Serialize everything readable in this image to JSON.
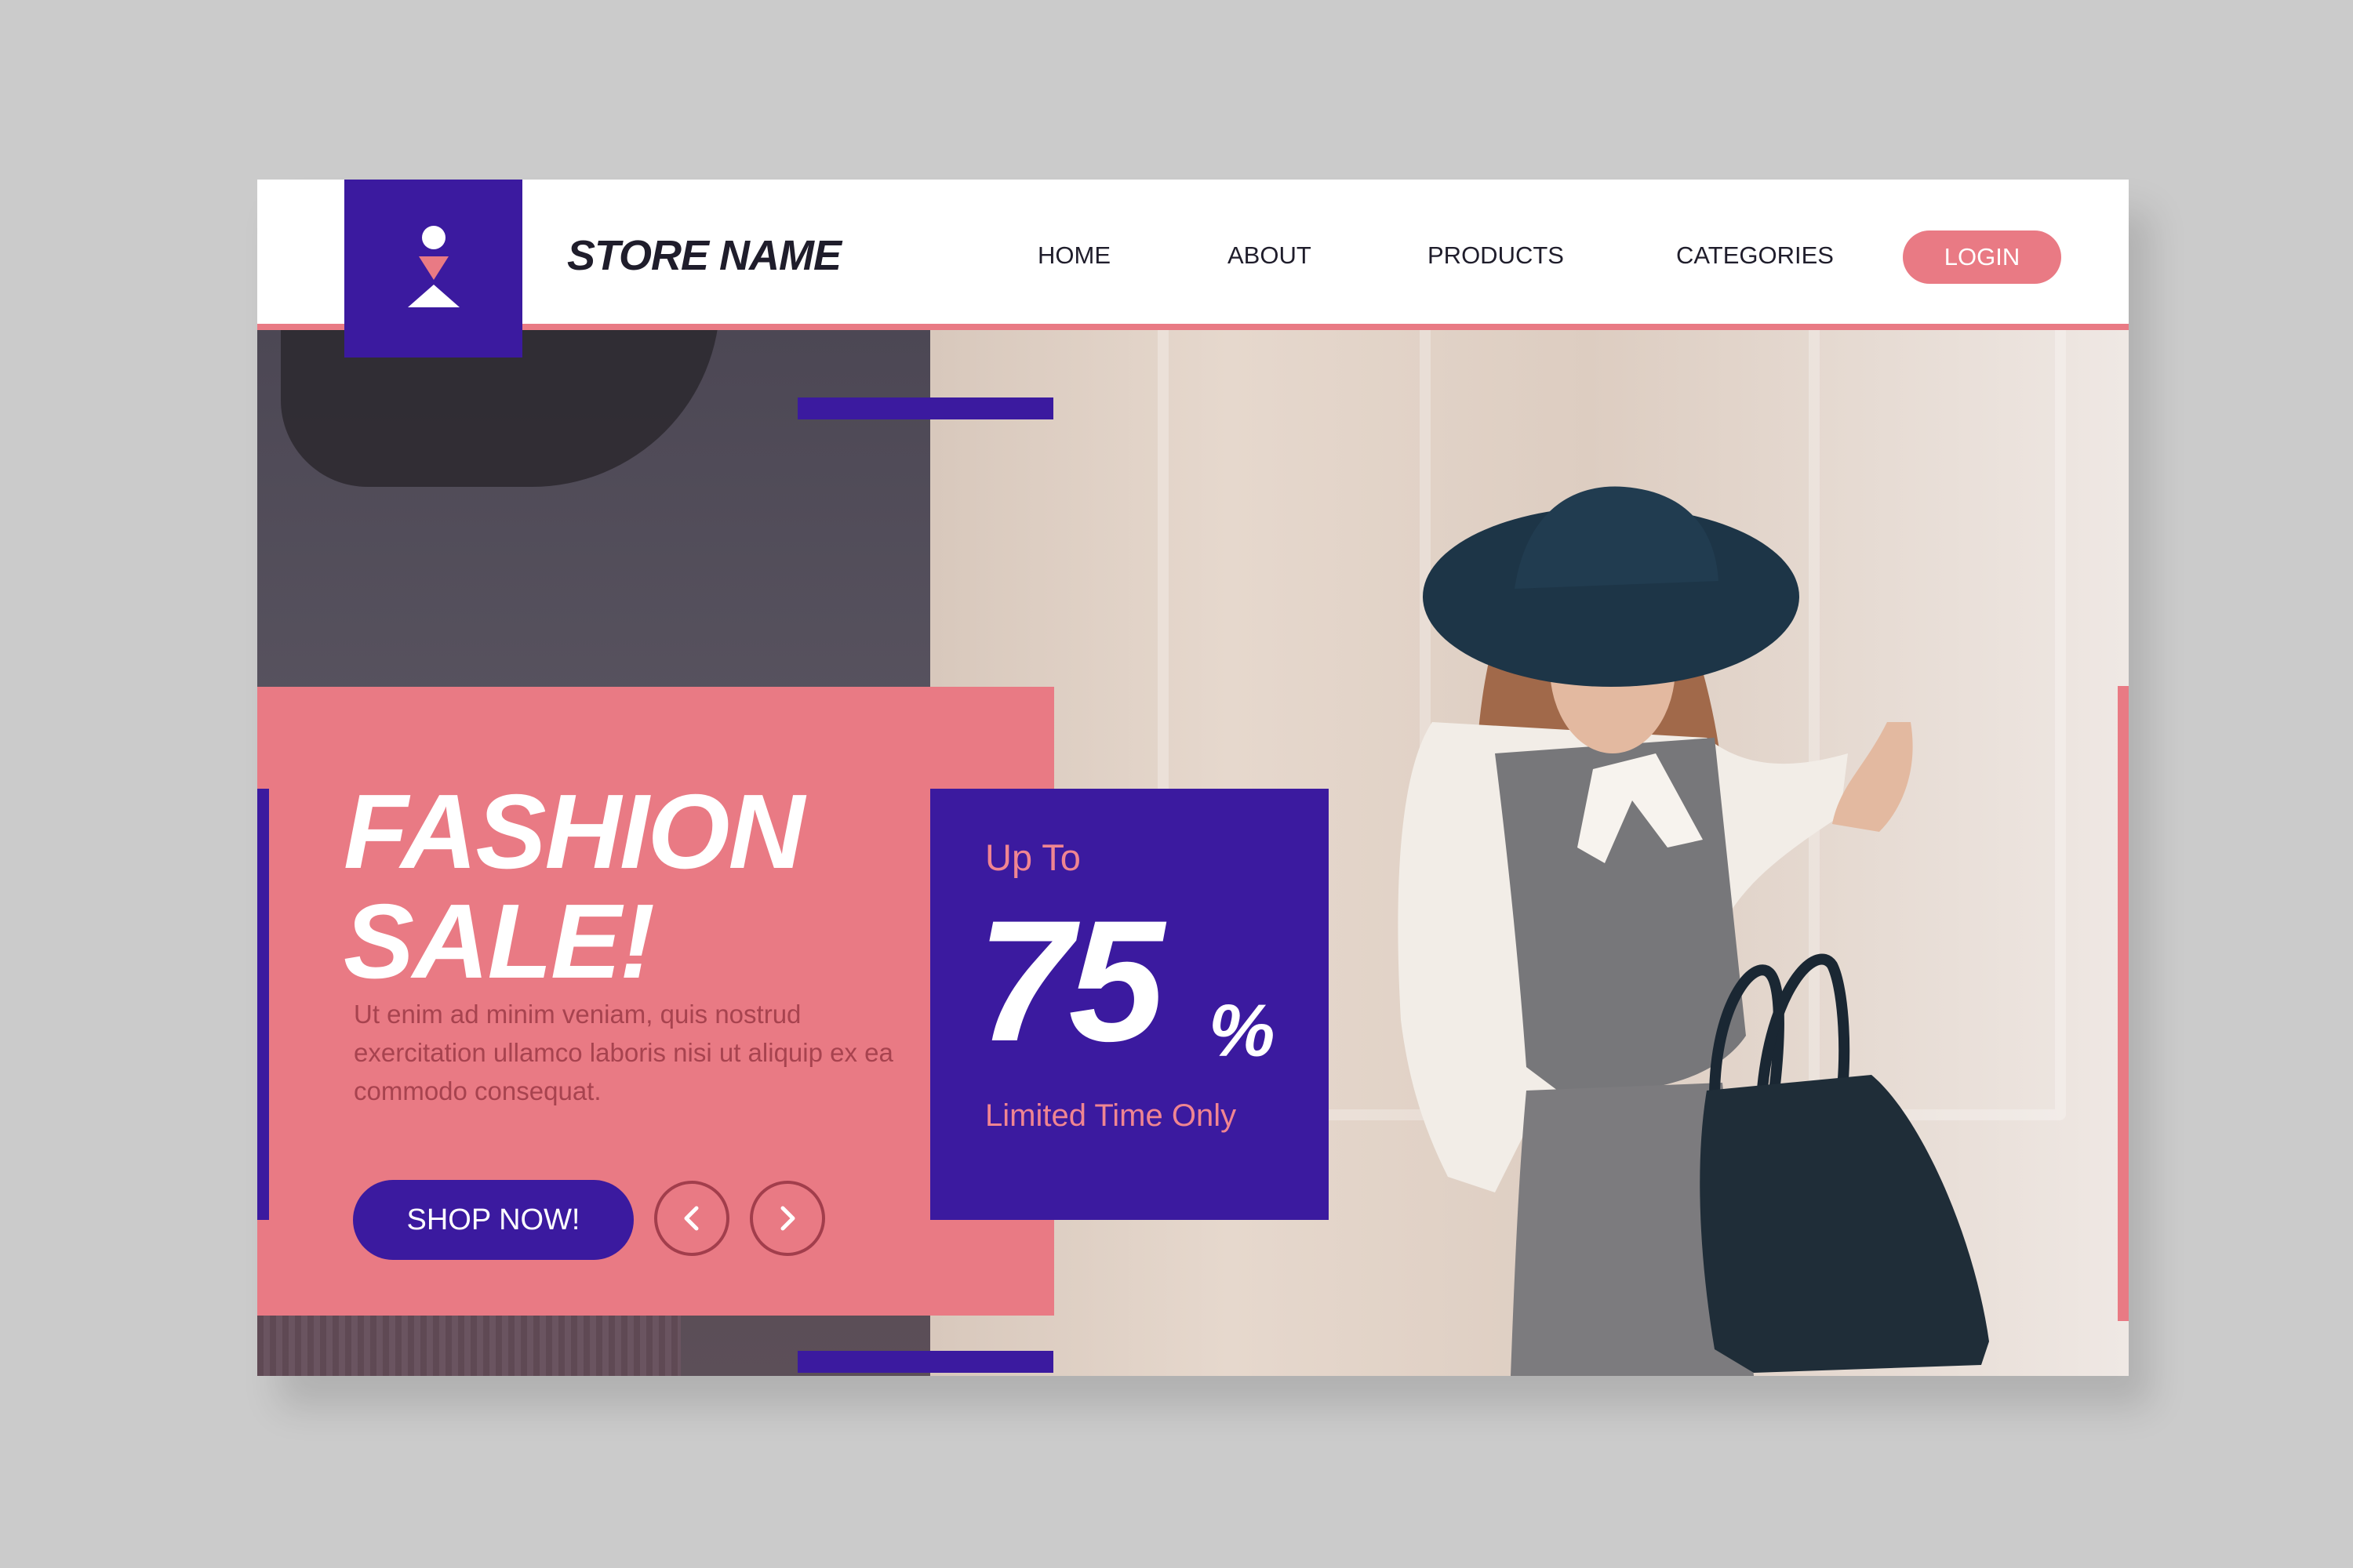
{
  "header": {
    "store_name": "STORE NAME",
    "nav": [
      "HOME",
      "ABOUT",
      "PRODUCTS",
      "CATEGORIES"
    ],
    "login_label": "LOGIN"
  },
  "hero": {
    "headline_line1": "FASHION",
    "headline_line2": "SALE!",
    "description": "Ut enim ad minim veniam, quis nostrud exercitation ullamco laboris nisi ut aliquip ex ea commodo consequat.",
    "cta_label": "SHOP NOW!",
    "prev_icon": "chevron-left-icon",
    "next_icon": "chevron-right-icon"
  },
  "promo": {
    "up_to": "Up To",
    "amount": "75",
    "unit": "%",
    "tagline": "Limited Time Only"
  },
  "colors": {
    "purple": "#3b1a9f",
    "pink": "#e97a84",
    "background": "#cbcbcb",
    "dark_text": "#1f1d2b"
  }
}
